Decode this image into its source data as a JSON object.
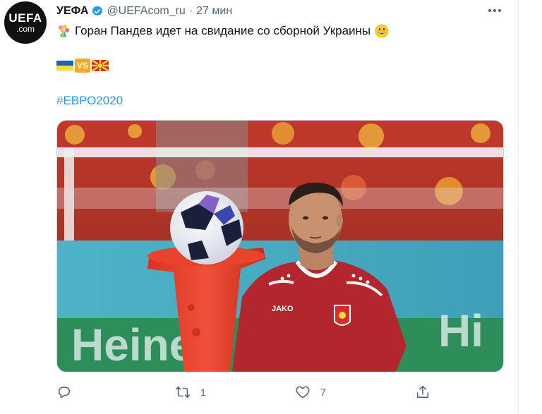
{
  "tweet": {
    "author_name": "УЕФА",
    "handle": "@UEFAcom_ru",
    "separator": "·",
    "time": "27 мин",
    "avatar_text": "UEFA",
    "avatar_subtext": ".com",
    "text": "Горан Пандев идет на свидание со сборной Украины",
    "hashtag": "#ЕВРО2020",
    "flags_vs": "VS",
    "media_shirt_brand": "JAKO",
    "media_banner_text": "Heine",
    "media_banner_text_right": "Hi"
  },
  "actions": {
    "reply_count": "",
    "retweet_count": "1",
    "like_count": "7"
  },
  "colors": {
    "link": "#1d9bf0",
    "secondary_text": "#536471",
    "verified": "#1d9bf0"
  }
}
